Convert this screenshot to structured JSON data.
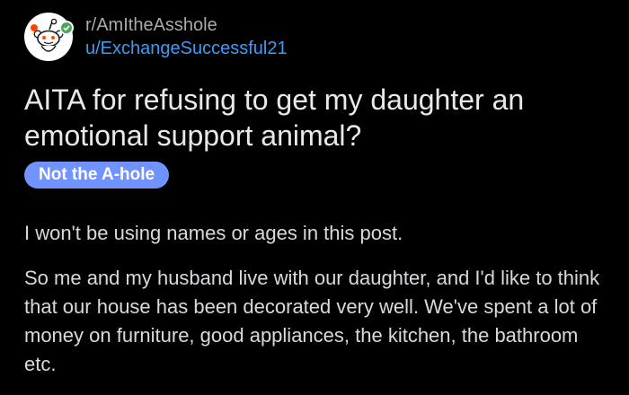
{
  "post": {
    "subreddit": "r/AmItheAsshole",
    "username": "u/ExchangeSuccessful21",
    "title": "AITA for refusing to get my daughter an emotional support animal?",
    "flair": "Not the A-hole",
    "paragraphs": [
      "I won't be using names or ages in this post.",
      "So me and my husband live with our daughter, and I'd like to think that our house has been decorated very well. We've spent a lot of money on furniture, good appliances, the kitchen, the bathroom etc."
    ]
  },
  "colors": {
    "background": "#000000",
    "text": "#d7dadc",
    "subreddit": "#a8aaab",
    "username": "#3d9bf6",
    "flair_bg": "#7193ff",
    "verified_badge": "#46a758"
  },
  "icons": {
    "avatar": "reddit-snoo-avatar",
    "badge": "verified-badge-icon"
  }
}
